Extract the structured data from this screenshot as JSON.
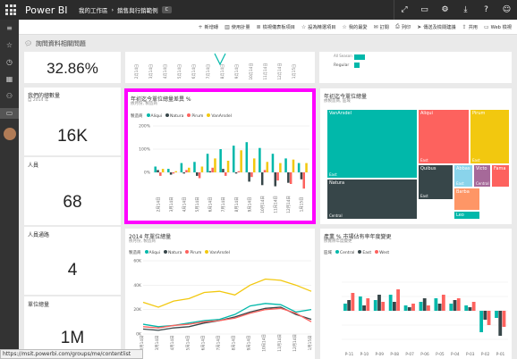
{
  "topbar": {
    "brand": "Power BI",
    "workspace": "我的工作區",
    "report": "銷售與行銷範例",
    "pill": "C"
  },
  "icons": [
    "expand-icon",
    "comment-icon",
    "settings-icon",
    "download-icon",
    "help-icon",
    "smiley-icon"
  ],
  "actions": [
    {
      "label": "新增磚",
      "icon": "plus-icon"
    },
    {
      "label": "使用計量",
      "icon": "chart-icon"
    },
    {
      "label": "檢視儀表板項目",
      "icon": "list-icon"
    },
    {
      "label": "設為精選項目",
      "icon": "star-icon"
    },
    {
      "label": "我的最愛",
      "icon": "star-icon"
    },
    {
      "label": "訂閱",
      "icon": "mail-icon"
    },
    {
      "label": "列印",
      "icon": "print-icon"
    },
    {
      "label": "傳送及檢閱建議",
      "icon": "send-icon"
    },
    {
      "label": "共用",
      "icon": "share-icon"
    },
    {
      "label": "Web 檢視",
      "icon": "web-icon"
    }
  ],
  "qna": {
    "placeholder": "詢問資料相關問題"
  },
  "tiles": {
    "percent": {
      "value": "32.86%"
    },
    "total_units": {
      "title": "我們的總數量",
      "subtitle": "自 2014 年",
      "value": "16K"
    },
    "people": {
      "title": "人員",
      "value": "68"
    },
    "channels": {
      "title": "人員通路",
      "value": "4"
    },
    "unit_count": {
      "title": "單位總量",
      "value": "1M"
    },
    "treemap": {
      "title": "年初迄今單位總量",
      "subtitle": "依製造商, 區域"
    },
    "line2014": {
      "title": "2014 年單位總量",
      "subtitle": "依月份, 製造商",
      "legend_label": "製造商"
    },
    "yoy": {
      "title": "產業 % 市場佔有率年度變更",
      "subtitle": "依實際年度變更",
      "legend_label": "區域"
    },
    "top_mid": {
      "legend_a": "All Season",
      "legend_b": "Regular"
    }
  },
  "chart_data": [
    {
      "type": "bar",
      "title": "年初迄今單位總量差異 %",
      "subtitle": "依月份, 製造商",
      "legend_label": "製造商",
      "categories": [
        "2月14日",
        "3月14日",
        "4月14日",
        "5月14日",
        "6月14日",
        "7月14日",
        "8月14日",
        "9月14日",
        "10月14日",
        "11月14日",
        "12月14日",
        "1月15日"
      ],
      "y_ticks": [
        "200%",
        "100%",
        "0%"
      ],
      "ylim": [
        -100,
        200
      ],
      "series": [
        {
          "name": "Aliqui",
          "color": "#01b8aa",
          "values": [
            25,
            15,
            40,
            45,
            80,
            100,
            115,
            130,
            105,
            80,
            60,
            40
          ]
        },
        {
          "name": "Natura",
          "color": "#374649",
          "values": [
            10,
            -10,
            -5,
            -15,
            5,
            15,
            -5,
            -40,
            -55,
            -60,
            -45,
            -30
          ]
        },
        {
          "name": "Pirum",
          "color": "#fd625e",
          "values": [
            -15,
            -5,
            10,
            -25,
            20,
            -15,
            5,
            -20,
            10,
            -35,
            -50,
            -70
          ]
        },
        {
          "name": "VanArsdel",
          "color": "#f2c80f",
          "values": [
            15,
            5,
            20,
            25,
            60,
            50,
            95,
            60,
            45,
            40,
            55,
            40
          ]
        }
      ]
    },
    {
      "type": "treemap",
      "title": "年初迄今單位總量",
      "subtitle": "依製造商, 區域",
      "cells": [
        {
          "label": "VanArsdel",
          "region": "East",
          "color": "#01b8aa"
        },
        {
          "label": "Aliqui",
          "region": "East",
          "color": "#fd625e"
        },
        {
          "label": "Pirum",
          "region": "East",
          "color": "#f2c80f"
        },
        {
          "label": "Natura",
          "region": "Central",
          "color": "#374649"
        },
        {
          "label": "Quibus",
          "region": "East",
          "color": "#374649"
        },
        {
          "label": "Abbas",
          "region": "East",
          "color": "#8ad4eb"
        },
        {
          "label": "Victo",
          "region": "Central",
          "color": "#a66999"
        },
        {
          "label": "Fama",
          "region": "",
          "color": "#fd625e"
        },
        {
          "label": "Barba",
          "region": "",
          "color": "#fe9666"
        },
        {
          "label": "Leo",
          "region": "",
          "color": "#01b8aa"
        }
      ]
    },
    {
      "type": "line",
      "title": "2014 年單位總量",
      "subtitle": "依月份, 製造商",
      "legend_label": "製造商",
      "categories": [
        "2月14日",
        "3月14日",
        "4月14日",
        "5月14日",
        "6月14日",
        "7月14日",
        "8月14日",
        "9月14日",
        "10月14日",
        "11月14日",
        "12月14日",
        "1月15日"
      ],
      "y_ticks": [
        "60K",
        "40K",
        "20K",
        "0K"
      ],
      "ylim": [
        0,
        60
      ],
      "series": [
        {
          "name": "Aliqui",
          "color": "#01b8aa",
          "values": [
            8,
            6,
            7,
            9,
            11,
            12,
            16,
            23,
            25,
            24,
            18,
            20
          ]
        },
        {
          "name": "Natura",
          "color": "#374649",
          "values": [
            4,
            3,
            5,
            6,
            9,
            11,
            14,
            18,
            21,
            22,
            16,
            12
          ]
        },
        {
          "name": "Pirum",
          "color": "#fd625e",
          "values": [
            6,
            5,
            7,
            8,
            10,
            11,
            13,
            17,
            20,
            21,
            17,
            10
          ]
        },
        {
          "name": "VanArsdel",
          "color": "#f2c80f",
          "values": [
            26,
            22,
            27,
            29,
            34,
            35,
            32,
            40,
            45,
            44,
            40,
            35
          ]
        }
      ]
    },
    {
      "type": "bar",
      "title": "產業 % 市場佔有率年度變更",
      "subtitle": "依實際年度變更",
      "legend_label": "區域",
      "categories": [
        "P-11",
        "P-10",
        "P-09",
        "P-08",
        "P-07",
        "P-06",
        "P-05",
        "P-04",
        "P-03",
        "P-02",
        "P-01"
      ],
      "series": [
        {
          "name": "Central",
          "color": "#01b8aa",
          "values": [
            0.4,
            0.8,
            0.6,
            0.9,
            0.3,
            0.5,
            0.7,
            0.4,
            0.3,
            -1.2,
            -0.4
          ]
        },
        {
          "name": "East",
          "color": "#374649",
          "values": [
            0.6,
            0.3,
            0.9,
            0.5,
            0.2,
            0.7,
            0.4,
            0.6,
            0.2,
            -0.5,
            -1.4
          ]
        },
        {
          "name": "West",
          "color": "#fd625e",
          "values": [
            1.0,
            0.7,
            0.5,
            1.2,
            0.4,
            0.3,
            0.9,
            0.7,
            0.5,
            -0.8,
            -0.9
          ]
        }
      ]
    }
  ],
  "status": {
    "url": "https://msit.powerbi.com/groups/me/contentlist"
  }
}
